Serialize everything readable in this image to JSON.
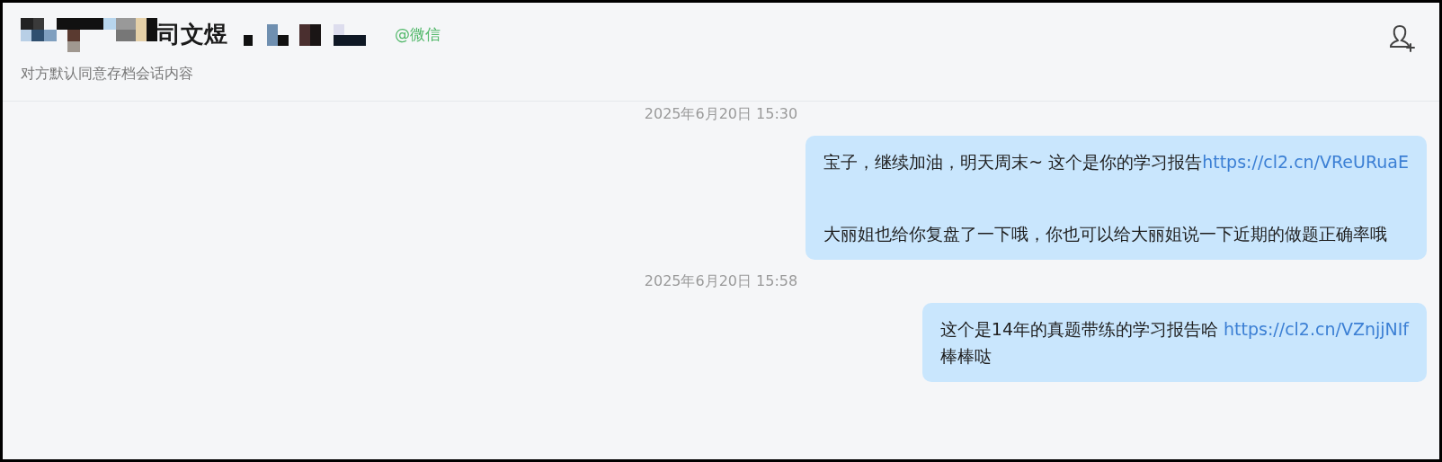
{
  "header": {
    "name": "司文煜",
    "source": "@微信",
    "subtitle": "对方默认同意存档会话内容"
  },
  "messages": [
    {
      "kind": "timestamp",
      "text": "2025年6月20日 15:30"
    },
    {
      "kind": "bubble",
      "blank_line_between": true,
      "paragraphs": [
        {
          "text": "宝子，继续加油，明天周末~  这个是你的学习报告",
          "link": "https://cl2.cn/VReURuaE"
        },
        {
          "text": "大丽姐也给你复盘了一下哦，你也可以给大丽姐说一下近期的做题正确率哦"
        }
      ]
    },
    {
      "kind": "timestamp",
      "text": "2025年6月20日 15:58"
    },
    {
      "kind": "bubble",
      "blank_line_between": false,
      "paragraphs": [
        {
          "text": "这个是14年的真题带练的学习报告哈 ",
          "link": "https://cl2.cn/VZnjjNIf"
        },
        {
          "text": "棒棒哒"
        }
      ]
    }
  ]
}
